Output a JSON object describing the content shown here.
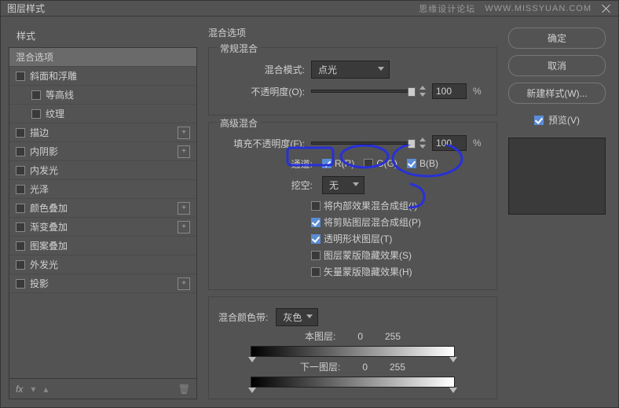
{
  "window": {
    "title": "图层样式",
    "watermark_label": "思缘设计论坛",
    "watermark_url": "WWW.MISSYUAN.COM"
  },
  "sidebar": {
    "header": "样式",
    "items": [
      {
        "label": "混合选项",
        "selected": true,
        "sub": false,
        "checkbox": false,
        "plus": false
      },
      {
        "label": "斜面和浮雕",
        "selected": false,
        "sub": false,
        "checkbox": true,
        "checked": false,
        "plus": false
      },
      {
        "label": "等高线",
        "selected": false,
        "sub": true,
        "checkbox": true,
        "checked": false,
        "plus": false
      },
      {
        "label": "纹理",
        "selected": false,
        "sub": true,
        "checkbox": true,
        "checked": false,
        "plus": false
      },
      {
        "label": "描边",
        "selected": false,
        "sub": false,
        "checkbox": true,
        "checked": false,
        "plus": true
      },
      {
        "label": "内阴影",
        "selected": false,
        "sub": false,
        "checkbox": true,
        "checked": false,
        "plus": true
      },
      {
        "label": "内发光",
        "selected": false,
        "sub": false,
        "checkbox": true,
        "checked": false,
        "plus": false
      },
      {
        "label": "光泽",
        "selected": false,
        "sub": false,
        "checkbox": true,
        "checked": false,
        "plus": false
      },
      {
        "label": "颜色叠加",
        "selected": false,
        "sub": false,
        "checkbox": true,
        "checked": false,
        "plus": true
      },
      {
        "label": "渐变叠加",
        "selected": false,
        "sub": false,
        "checkbox": true,
        "checked": false,
        "plus": true
      },
      {
        "label": "图案叠加",
        "selected": false,
        "sub": false,
        "checkbox": true,
        "checked": false,
        "plus": false
      },
      {
        "label": "外发光",
        "selected": false,
        "sub": false,
        "checkbox": true,
        "checked": false,
        "plus": false
      },
      {
        "label": "投影",
        "selected": false,
        "sub": false,
        "checkbox": true,
        "checked": false,
        "plus": true
      }
    ]
  },
  "main": {
    "title": "混合选项",
    "general": {
      "legend": "常规混合",
      "blend_mode_label": "混合模式:",
      "blend_mode_value": "点光",
      "opacity_label": "不透明度(O):",
      "opacity_value": "100",
      "pct": "%"
    },
    "advanced": {
      "legend": "高级混合",
      "fill_label": "填充不透明度(F):",
      "fill_value": "100",
      "pct": "%",
      "channels_label": "通道:",
      "ch_r": "R(R)",
      "ch_r_on": true,
      "ch_g": "G(G)",
      "ch_g_on": false,
      "ch_b": "B(B)",
      "ch_b_on": true,
      "knockout_label": "挖空:",
      "knockout_value": "无",
      "opts": [
        {
          "label": "将内部效果混合成组(I)",
          "on": false
        },
        {
          "label": "将剪贴图层混合成组(P)",
          "on": true
        },
        {
          "label": "透明形状图层(T)",
          "on": true
        },
        {
          "label": "图层蒙版隐藏效果(S)",
          "on": false
        },
        {
          "label": "矢量蒙版隐藏效果(H)",
          "on": false
        }
      ]
    },
    "blendif": {
      "label": "混合颜色带:",
      "value": "灰色",
      "this_label": "本图层:",
      "this_lo": "0",
      "this_hi": "255",
      "under_label": "下一图层:",
      "under_lo": "0",
      "under_hi": "255"
    }
  },
  "buttons": {
    "ok": "确定",
    "cancel": "取消",
    "new_style": "新建样式(W)...",
    "preview": "预览(V)"
  }
}
